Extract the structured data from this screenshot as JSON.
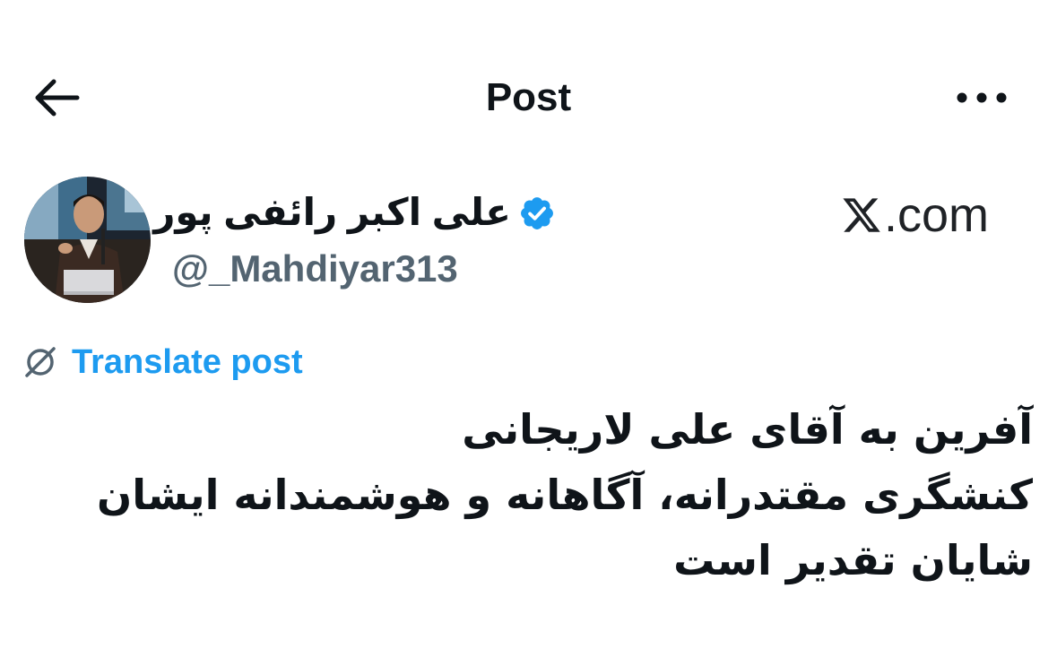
{
  "header": {
    "title": "Post",
    "back_icon": "arrow-left-icon",
    "more_icon": "more-horizontal-icon"
  },
  "author": {
    "display_name": "علی اکبر رائفی پور",
    "handle": "@_Mahdiyar313",
    "verified_icon": "verified-badge-icon"
  },
  "watermark": {
    "text": ".com",
    "logo": "x-logo-icon"
  },
  "translate": {
    "label": "Translate post",
    "icon": "translate-globe-icon"
  },
  "post": {
    "lines": [
      "آفرین به آقای علی لاریجانی",
      "کنشگری مقتدرانه، آگاهانه و هوشمندانه ایشان",
      "شایان تقدیر است"
    ]
  },
  "colors": {
    "text": "#0f1419",
    "secondary": "#536471",
    "accent": "#1d9bf0"
  }
}
